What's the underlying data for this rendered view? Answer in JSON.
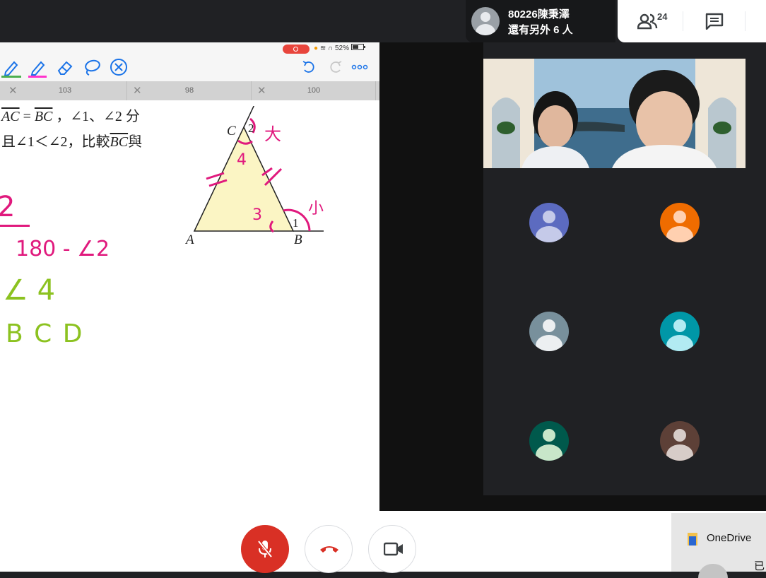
{
  "meeting": {
    "presenter_name": "80226陳秉澤",
    "presenter_sub": "還有另外 6 人",
    "participant_count": "24"
  },
  "device_status": {
    "battery": "52%"
  },
  "whiteboard": {
    "tabs": [
      {
        "label": "103"
      },
      {
        "label": "98"
      },
      {
        "label": "100"
      }
    ],
    "problem_line1_a": "AC",
    "problem_line1_b": " = ",
    "problem_line1_c": "BC",
    "problem_line1_d": " ，∠1、∠2 分",
    "problem_line2_a": "且∠1＜∠2，比較",
    "problem_line2_b": "BC",
    "problem_line2_c": "與",
    "figure_labels": {
      "a": "A",
      "b": "B",
      "c": "C",
      "angle1": "1",
      "angle2": "2"
    },
    "handwriting": {
      "angle4": "4",
      "angle3": "3",
      "big": "大",
      "small": "小",
      "line_a": "2",
      "line_b": "180 - ∠2",
      "line_c": "∠ 4",
      "line_d": "B C D"
    },
    "colors": {
      "magenta": "#e0197d",
      "green": "#8cc220",
      "triangle_fill": "#fbf5c4"
    }
  },
  "gallery": {
    "tiles": [
      {
        "name": "participant-tile-1",
        "color": "#5c6bc0"
      },
      {
        "name": "participant-tile-2",
        "color": "#ef6c00"
      },
      {
        "name": "participant-tile-3",
        "color": "#78909c"
      },
      {
        "name": "participant-tile-4",
        "color": "#0097a7"
      },
      {
        "name": "participant-tile-5",
        "color": "#00594c"
      },
      {
        "name": "participant-tile-6",
        "color": "#5d4037"
      }
    ]
  },
  "notification": {
    "app": "OneDrive",
    "extra": "已"
  },
  "colors": {
    "meet_red": "#d93025",
    "dark_bg": "#202124"
  }
}
